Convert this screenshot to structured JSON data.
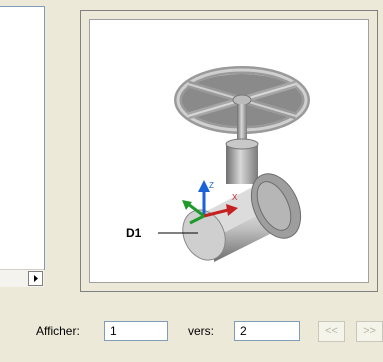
{
  "preview": {
    "callout_label": "D1",
    "axis_x_label": "X",
    "axis_z_label": "Z"
  },
  "pager": {
    "show_label": "Afficher:",
    "from_value": "1",
    "to_label": "vers:",
    "to_value": "2",
    "prev_label": "<<",
    "next_label": ">>"
  },
  "icons": {
    "scroll_right": "chevron-right-icon",
    "valve": "gate-valve-image"
  }
}
